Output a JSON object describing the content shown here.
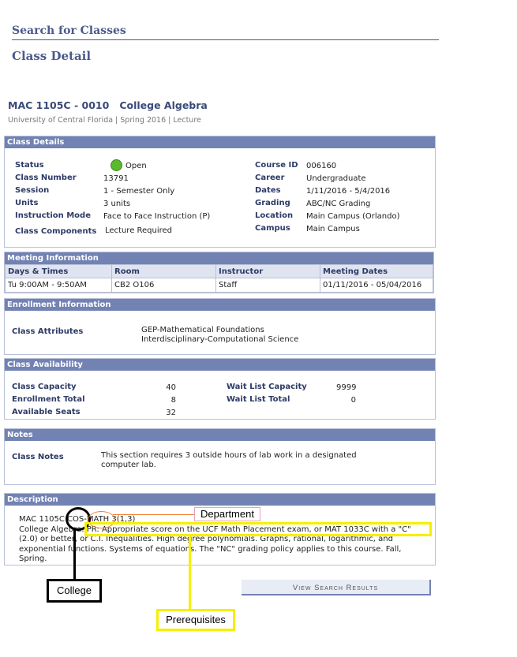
{
  "header": {
    "search_title": "Search for Classes",
    "page_title": "Class Detail"
  },
  "course": {
    "title": "MAC 1105C - 0010   College Algebra",
    "subtitle": "University of Central Florida | Spring 2016 | Lecture"
  },
  "class_details": {
    "header": "Class Details",
    "left": [
      {
        "label": "Status",
        "value": "Open"
      },
      {
        "label": "Class Number",
        "value": "13791"
      },
      {
        "label": "Session",
        "value": "1 - Semester Only"
      },
      {
        "label": "Units",
        "value": "3 units"
      },
      {
        "label": "Instruction Mode",
        "value": "Face to Face Instruction (P)"
      },
      {
        "label": "Class Components",
        "value": "Lecture Required"
      }
    ],
    "right": [
      {
        "label": "Course ID",
        "value": "006160"
      },
      {
        "label": "Career",
        "value": "Undergraduate"
      },
      {
        "label": "Dates",
        "value": "1/11/2016 - 5/4/2016"
      },
      {
        "label": "Grading",
        "value": "ABC/NC Grading"
      },
      {
        "label": "Location",
        "value": "Main Campus (Orlando)"
      },
      {
        "label": "Campus",
        "value": "Main Campus"
      }
    ],
    "status_color": "#5cb82e"
  },
  "meeting_info": {
    "header": "Meeting Information",
    "columns": [
      "Days & Times",
      "Room",
      "Instructor",
      "Meeting Dates"
    ],
    "rows": [
      [
        "Tu 9:00AM - 9:50AM",
        "CB2 O106",
        "Staff",
        "01/11/2016 - 05/04/2016"
      ]
    ]
  },
  "enrollment_info": {
    "header": "Enrollment Information",
    "label": "Class Attributes",
    "values": [
      "GEP-Mathematical Foundations",
      "Interdisciplinary-Computational Science"
    ]
  },
  "availability": {
    "header": "Class Availability",
    "left": [
      {
        "label": "Class Capacity",
        "value": "40"
      },
      {
        "label": "Enrollment Total",
        "value": "8"
      },
      {
        "label": "Available Seats",
        "value": "32"
      }
    ],
    "right": [
      {
        "label": "Wait List Capacity",
        "value": "9999"
      },
      {
        "label": "Wait List Total",
        "value": "0"
      }
    ]
  },
  "notes": {
    "header": "Notes",
    "label": "Class Notes",
    "lines": [
      "This section requires 3 outside hours of lab work in a designated",
      "computer lab."
    ]
  },
  "description": {
    "header": "Description",
    "lines": [
      "MAC 1105C COS-MATH  3(1,3)",
      "College Algebra: PR: Appropriate score on the UCF Math Placement exam, or MAT 1033C with a \"C\"",
      "(2.0) or better, or C.I. Inequalities. High degree polynomials. Graphs, rational, logarithmic, and",
      "exponential functions. Systems of equations. The \"NC\" grading policy applies to this course. Fall,",
      "Spring."
    ]
  },
  "buttons": {
    "view_results": "View Search Results"
  },
  "annotations": {
    "department": "Department",
    "college": "College",
    "prerequisites": "Prerequisites",
    "colors": {
      "college": "#000000",
      "department": "#f08030",
      "prerequisites": "#f5f000"
    }
  }
}
